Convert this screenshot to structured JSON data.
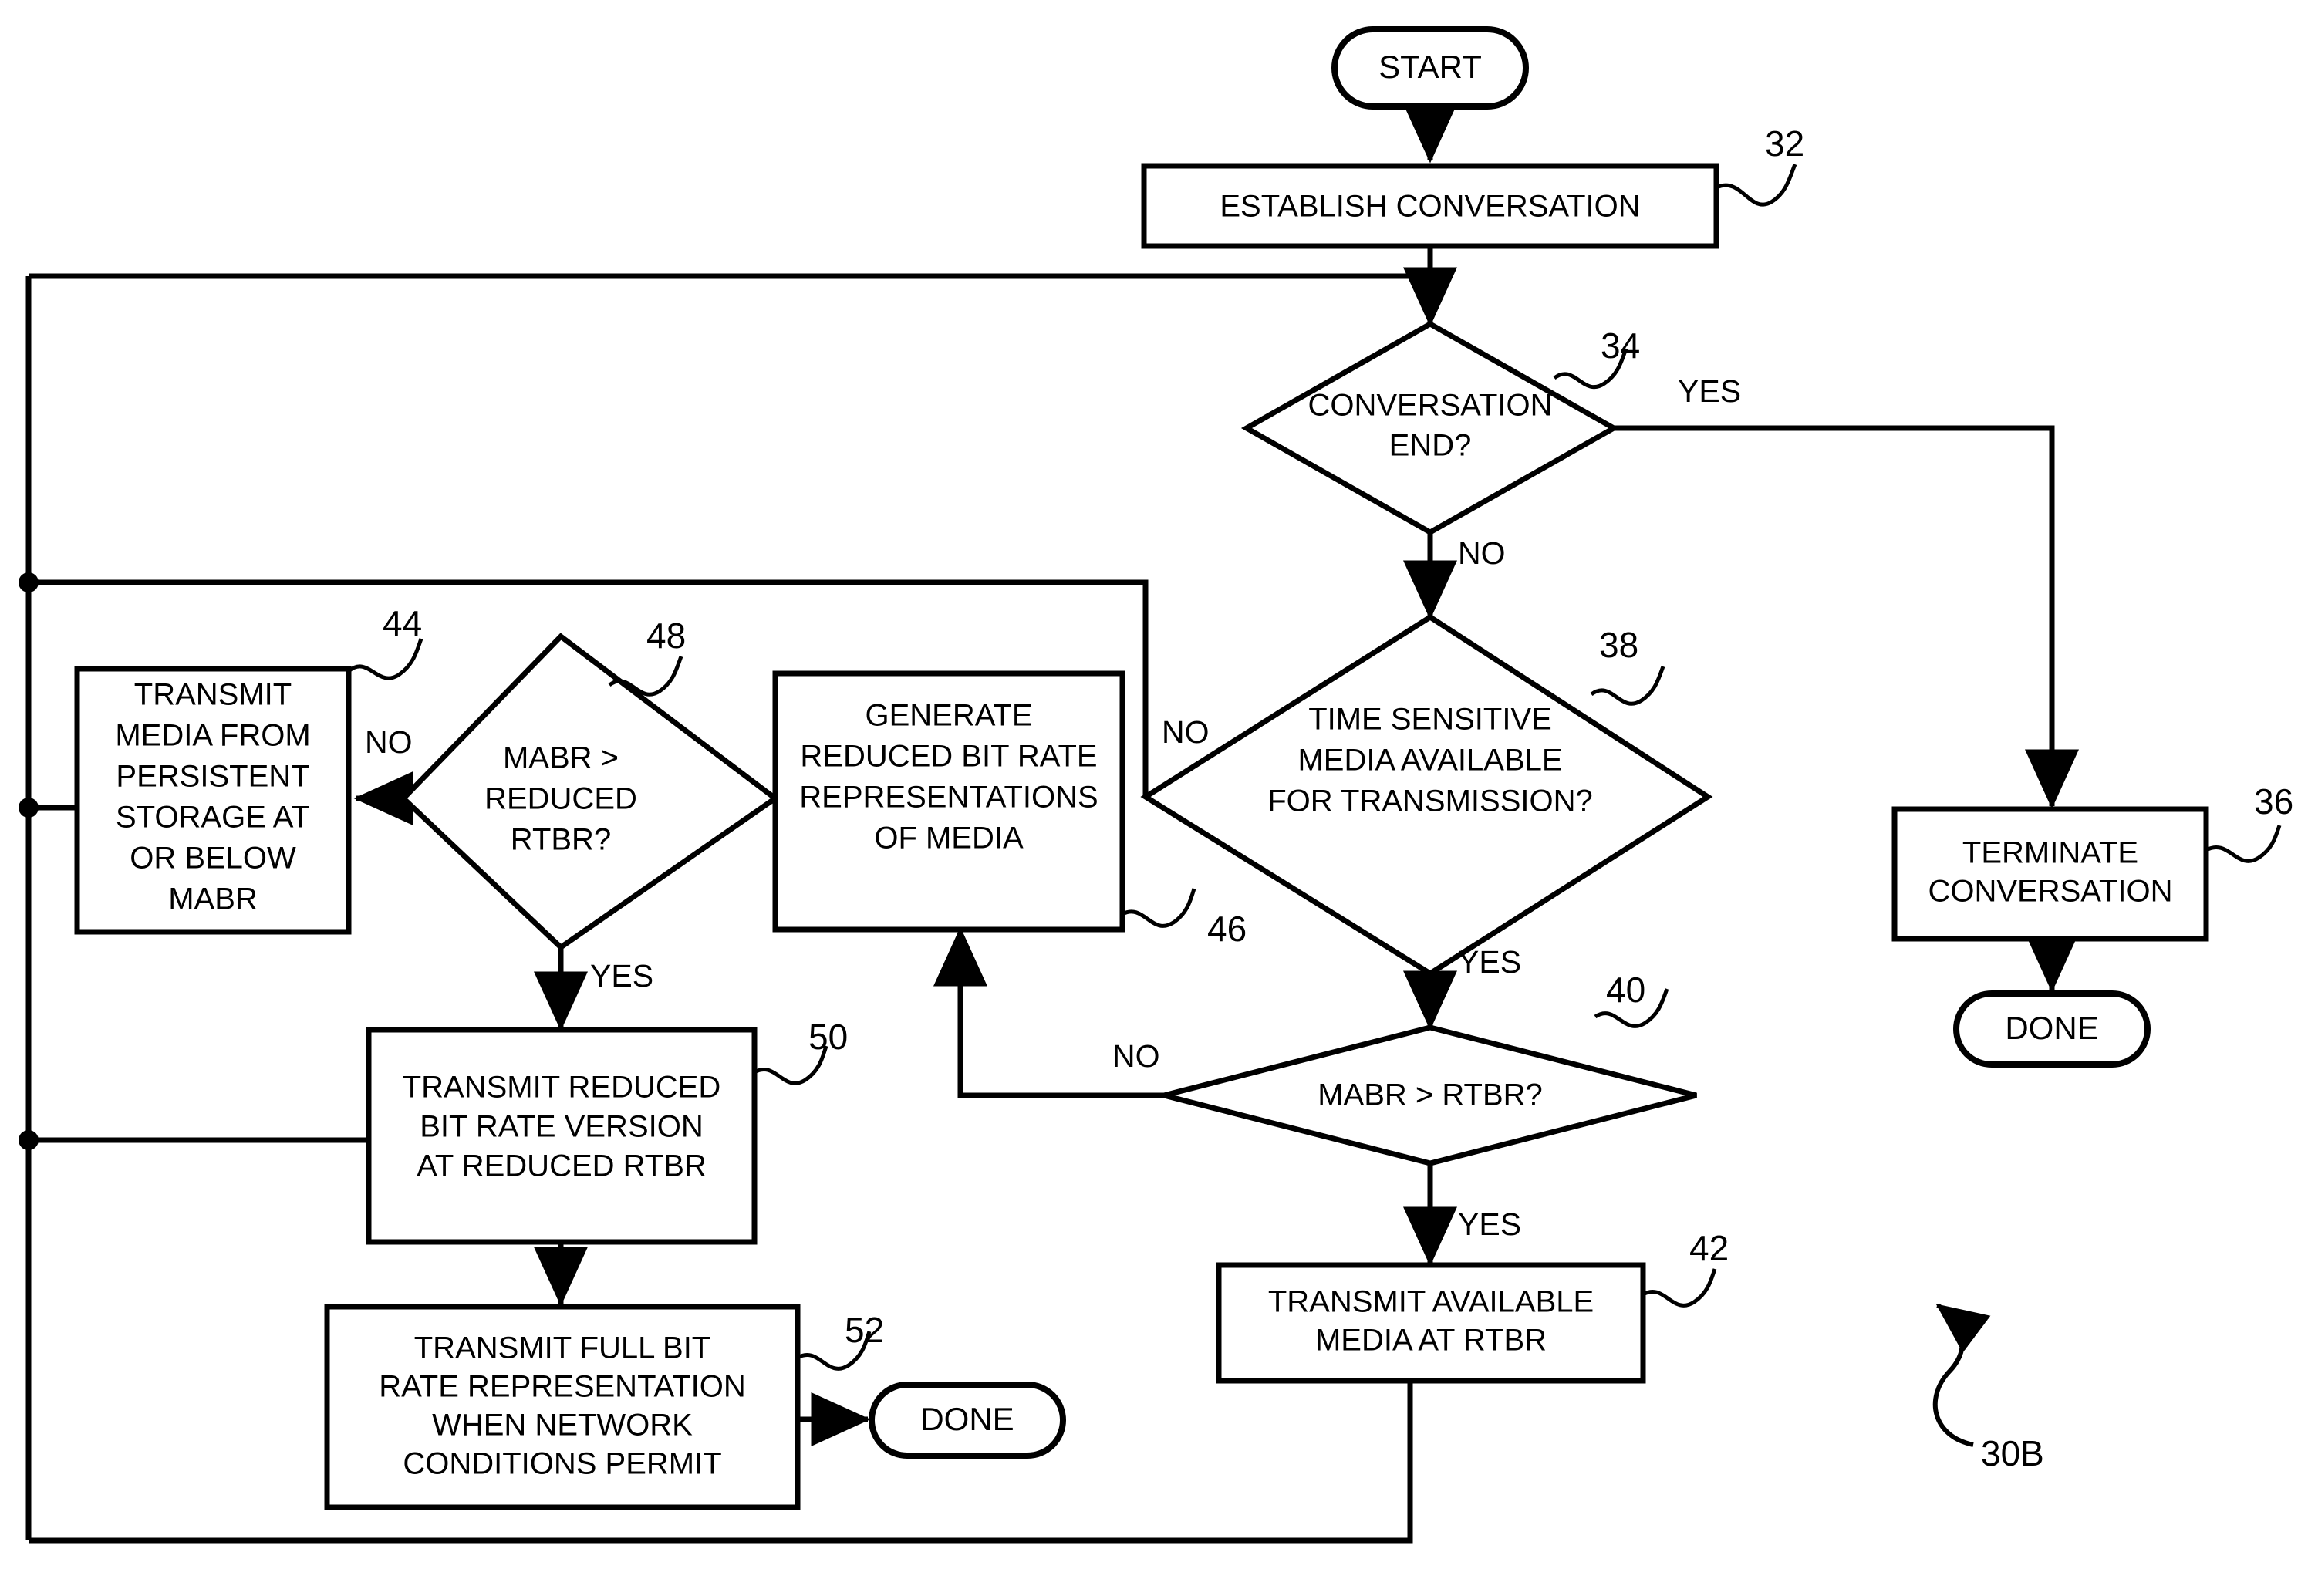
{
  "figure": {
    "label": "30B",
    "label_kind": "figure-reference-callout"
  },
  "nodes": {
    "start": {
      "ref": "",
      "text": "START",
      "shape": "terminator"
    },
    "establish": {
      "ref": "32",
      "text": "ESTABLISH CONVERSATION",
      "shape": "process"
    },
    "conv_end": {
      "ref": "34",
      "lines": [
        "CONVERSATION",
        "END?"
      ],
      "shape": "decision"
    },
    "terminate": {
      "ref": "36",
      "lines": [
        "TERMINATE",
        "CONVERSATION"
      ],
      "shape": "process"
    },
    "done_right": {
      "ref": "",
      "text": "DONE",
      "shape": "terminator"
    },
    "time_sensitive": {
      "ref": "38",
      "lines": [
        "TIME SENSITIVE",
        "MEDIA AVAILABLE",
        "FOR TRANSMISSION?"
      ],
      "shape": "decision"
    },
    "mabr_rtbr": {
      "ref": "40",
      "lines": [
        "MABR > RTBR?"
      ],
      "shape": "decision"
    },
    "transmit_available": {
      "ref": "42",
      "lines": [
        "TRANSMIT AVAILABLE",
        "MEDIA AT RTBR"
      ],
      "shape": "process"
    },
    "transmit_persistent": {
      "ref": "44",
      "lines": [
        "TRANSMIT",
        "MEDIA FROM",
        "PERSISTENT",
        "STORAGE AT",
        "OR BELOW",
        "MABR"
      ],
      "shape": "process"
    },
    "generate_reduced": {
      "ref": "46",
      "lines": [
        "GENERATE",
        "REDUCED BIT RATE",
        "REPRESENTATIONS",
        "OF MEDIA"
      ],
      "shape": "process"
    },
    "mabr_reduced": {
      "ref": "48",
      "lines": [
        "MABR >",
        "REDUCED",
        "RTBR?"
      ],
      "shape": "decision"
    },
    "transmit_reduced": {
      "ref": "50",
      "lines": [
        "TRANSMIT REDUCED",
        "BIT RATE VERSION",
        "AT REDUCED RTBR"
      ],
      "shape": "process"
    },
    "transmit_full": {
      "ref": "52",
      "lines": [
        "TRANSMIT FULL BIT",
        "RATE REPRESENTATION",
        "WHEN NETWORK",
        "CONDITIONS PERMIT"
      ],
      "shape": "process"
    },
    "done_left": {
      "ref": "",
      "text": "DONE",
      "shape": "terminator"
    }
  },
  "edge_labels": {
    "conv_end_yes": "YES",
    "conv_end_no": "NO",
    "time_sensitive_no": "NO",
    "time_sensitive_yes": "YES",
    "mabr_rtbr_no": "NO",
    "mabr_rtbr_yes": "YES",
    "mabr_reduced_no": "NO",
    "mabr_reduced_yes": "YES"
  },
  "colors": {
    "stroke": "#000000",
    "fill": "#ffffff",
    "background": "#ffffff"
  }
}
